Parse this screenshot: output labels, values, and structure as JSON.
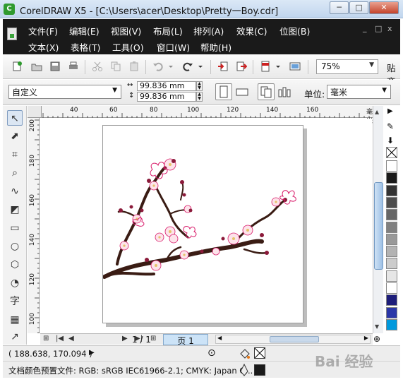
{
  "window": {
    "title": "CorelDRAW X5 - [C:\\Users\\acer\\Desktop\\Pretty一Boy.cdr]",
    "app_icon_letter": "C",
    "minimize": "─",
    "maximize": "□",
    "close": "✕"
  },
  "menu": {
    "row1": [
      "文件(F)",
      "编辑(E)",
      "视图(V)",
      "布局(L)",
      "排列(A)",
      "效果(C)",
      "位图(B)"
    ],
    "row2": [
      "文本(X)",
      "表格(T)",
      "工具(O)",
      "窗口(W)",
      "帮助(H)"
    ],
    "mdi_controls": [
      "_",
      "□",
      "x"
    ]
  },
  "toolbar": {
    "zoom": "75%",
    "snap_label": "贴齐"
  },
  "property_bar": {
    "paper": "自定义",
    "width": "99.836 mm",
    "height": "99.836 mm",
    "unit_label": "单位:",
    "unit": "毫米"
  },
  "ruler": {
    "top_labels": [
      "40",
      "60",
      "80",
      "100",
      "120",
      "140",
      "160"
    ],
    "left_labels": [
      "200",
      "180",
      "160",
      "140",
      "120",
      "100"
    ],
    "unit": "毫米"
  },
  "navigator": {
    "page_count": "1 / 1",
    "page_tab": "页 1"
  },
  "status": {
    "coords": "( 188.638, 170.094 )",
    "color_profile": "文档颜色预置文件: RGB: sRGB IEC61966-2.1; CMYK: Japan C..."
  },
  "watermark": "Bai 经验",
  "colors": {
    "palette": [
      "#ffffff",
      "#1a1a1a",
      "#333333",
      "#4d4d4d",
      "#666666",
      "#808080",
      "#999999",
      "#b3b3b3",
      "#cccccc",
      "#e6e6e6",
      "#ffffff",
      "#1e1e7a",
      "#2b37a8",
      "#0099dd"
    ],
    "branch": "#3a1c14",
    "bud": "#8b1a3a",
    "petal": "#fde3ea",
    "outline": "#d81b6a"
  },
  "icons": {
    "tools": [
      "pick-tool-icon",
      "shape-tool-icon",
      "crop-tool-icon",
      "zoom-tool-icon",
      "freehand-tool-icon",
      "smart-fill-icon",
      "rectangle-tool-icon",
      "ellipse-tool-icon",
      "polygon-tool-icon",
      "basic-shapes-icon",
      "text-tool-icon",
      "table-tool-icon",
      "dimension-tool-icon"
    ]
  }
}
